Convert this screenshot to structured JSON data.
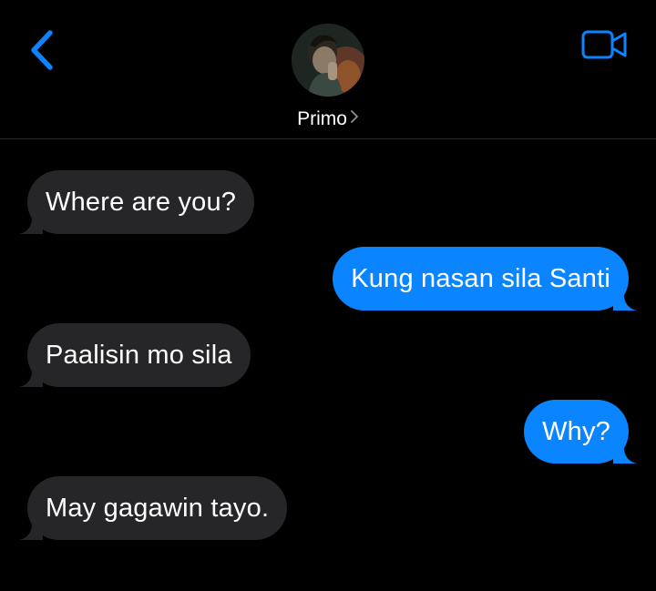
{
  "header": {
    "contact_name": "Primo",
    "back_icon": "chevron-left-icon",
    "video_icon": "video-camera-icon",
    "accent_color": "#0a84ff"
  },
  "messages": [
    {
      "direction": "incoming",
      "text": "Where are you?"
    },
    {
      "direction": "outgoing",
      "text": "Kung nasan sila Santi"
    },
    {
      "direction": "incoming",
      "text": "Paalisin mo sila"
    },
    {
      "direction": "outgoing",
      "text": "Why?"
    },
    {
      "direction": "incoming",
      "text": "May gagawin tayo."
    }
  ],
  "colors": {
    "background": "#000000",
    "incoming_bubble": "#262628",
    "outgoing_bubble": "#0a84ff",
    "text": "#ffffff"
  }
}
